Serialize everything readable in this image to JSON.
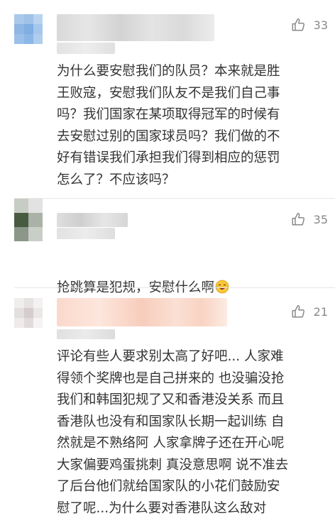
{
  "comments": [
    {
      "likes": "33",
      "text": "为什么要安慰我们的队员？本来就是胜\n王败寇，安慰我们队友不是我们自己事\n吗？我们国家在某项取得冠军的时候有\n去安慰过别的国家球员吗？我们做的不\n好有错误我们承担我们得到相应的惩罚\n怎么了？不应该吗？"
    },
    {
      "likes": "35",
      "text": "抢跳算是犯规，安慰什么啊",
      "emoji_icon": "laughing-tears-emoji-icon"
    },
    {
      "likes": "21",
      "text": "评论有些人要求别太高了好吧... 人家难\n得领个奖牌也是自己拼来的 也没骗没抢\n我们和韩国犯规了又和香港没关系 而且\n香港队也没有和国家队长期一起训练 自\n然就是不熟络阿 人家拿牌子还在开心呢\n大家偏要鸡蛋挑刺 真没意思啊 说不准去\n了后台他们就给国家队的小花们鼓励安\n慰了呢...为什么要对香港队这么敌对"
    }
  ],
  "colors": {
    "text": "#333333",
    "like_count": "#888888",
    "divider": "#e6e6e6",
    "background": "#ffffff"
  },
  "icons": {
    "like": "thumbs-up-icon"
  }
}
